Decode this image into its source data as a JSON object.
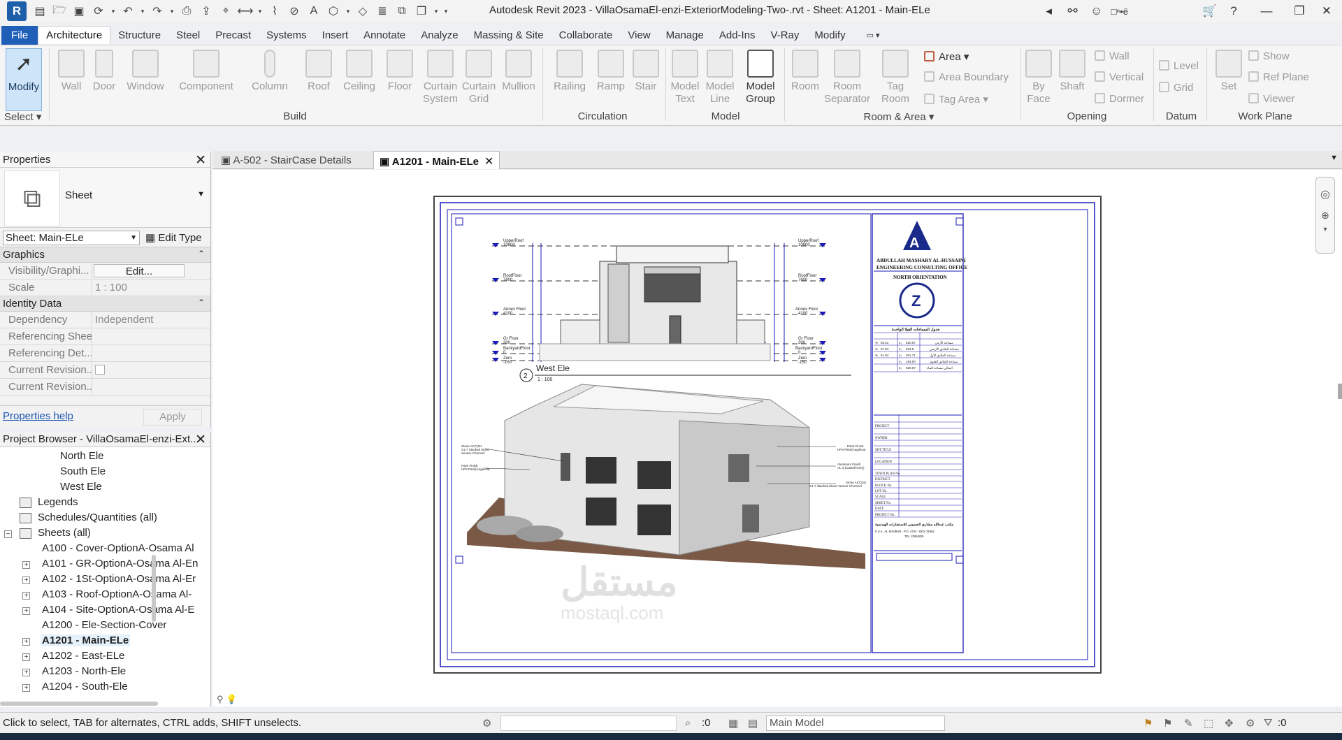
{
  "app": {
    "window_title": "Autodesk Revit 2023 - VillaOsamaEl-enzi-ExteriorModeling-Two-.rvt - Sheet: A1201 - Main-ELe",
    "user": "□ⁿ•ë",
    "logo": "R"
  },
  "ribbon_tabs": [
    "File",
    "Architecture",
    "Structure",
    "Steel",
    "Precast",
    "Systems",
    "Insert",
    "Annotate",
    "Analyze",
    "Massing & Site",
    "Collaborate",
    "View",
    "Manage",
    "Add-Ins",
    "V-Ray",
    "Modify"
  ],
  "ribbon": {
    "modify": "Modify",
    "select_panel": "Select",
    "build": {
      "buttons": [
        "Wall",
        "Door",
        "Window",
        "Component",
        "Column",
        "Roof",
        "Ceiling",
        "Floor",
        "Curtain System",
        "Curtain Grid",
        "Mullion"
      ],
      "label": "Build"
    },
    "circulation": {
      "buttons": [
        "Railing",
        "Ramp",
        "Stair"
      ],
      "label": "Circulation"
    },
    "model": {
      "buttons": [
        "Model Text",
        "Model Line",
        "Model Group"
      ],
      "label": "Model"
    },
    "room_area": {
      "buttons": [
        "Room",
        "Room Separator",
        "Tag Room"
      ],
      "small": [
        "Area",
        "Area  Boundary",
        "Tag  Area"
      ],
      "label": "Room & Area"
    },
    "opening": {
      "buttons": [
        "By Face",
        "Shaft"
      ],
      "small": [
        "Wall",
        "Vertical",
        "Dormer"
      ],
      "label": "Opening"
    },
    "datum": {
      "small": [
        "Level",
        "Grid"
      ],
      "label": "Datum"
    },
    "work_plane": {
      "buttons": [
        "Set"
      ],
      "small": [
        "Show",
        "Ref  Plane",
        "Viewer"
      ],
      "label": "Work Plane"
    }
  },
  "properties": {
    "title": "Properties",
    "type_name": "Sheet",
    "selector": "Sheet: Main-ELe",
    "edit_type": "Edit Type",
    "categories": [
      {
        "name": "Graphics",
        "rows": [
          {
            "name": "Visibility/Graphi...",
            "value": "Edit..."
          },
          {
            "name": "Scale",
            "value": "1 : 100"
          }
        ]
      },
      {
        "name": "Identity Data",
        "rows": [
          {
            "name": "Dependency",
            "value": "Independent"
          },
          {
            "name": "Referencing Sheet",
            "value": ""
          },
          {
            "name": "Referencing Det...",
            "value": ""
          },
          {
            "name": "Current Revision...",
            "value": ""
          },
          {
            "name": "Current Revision...",
            "value": ""
          }
        ]
      }
    ],
    "help": "Properties help",
    "apply": "Apply"
  },
  "browser": {
    "title": "Project Browser - VillaOsamaEl-enzi-Ext...",
    "items": [
      "North Ele",
      "South Ele",
      "West Ele",
      "Legends",
      "Schedules/Quantities (all)",
      "Sheets (all)",
      "A100 - Cover-OptionA-Osama Al",
      "A101 - GR-OptionA-Osama Al-En",
      "A102 - 1St-OptionA-Osama Al-Er",
      "A103 - Roof-OptionA-Osama Al-",
      "A104 - Site-OptionA-Osama Al-E",
      "A1200 - Ele-Section-Cover",
      "A1201 - Main-ELe",
      "A1202 - East-ELe",
      "A1203 - North-Ele",
      "A1204 - South-Ele"
    ]
  },
  "doc_tabs": [
    "A-502 - StairCase Details",
    "A1201 - Main-ELe"
  ],
  "sheet": {
    "elevation_view_number": "2",
    "elevation_title": "West Ele",
    "elevation_scale": "1 : 100",
    "levels_left": [
      {
        "name": "UpperRoof",
        "elev": "10800"
      },
      {
        "name": "RoofFloor",
        "elev": "7600"
      },
      {
        "name": "Annex Floor",
        "elev": "4100"
      },
      {
        "name": "Gr Floor",
        "elev": "300"
      },
      {
        "name": "BackyardFloor",
        "elev": "0"
      },
      {
        "name": "Zero",
        "elev": "-150"
      }
    ],
    "title_block": {
      "company_line1": "ABDULLAH MASHARY AL-HUSSAINI",
      "company_line2": "ENGINEERING CONSULTING OFFICE",
      "north": "NORTH ORIENTATION",
      "area_table_title": "جدول المساحات الفيلا الواحدة",
      "area_rows": [
        [
          "%",
          "56.61",
          "2₁",
          "520.67",
          "مساحة الأرض"
        ],
        [
          "%",
          "57.84",
          "2₁",
          "294.8",
          "مساحة الطابق الأرضي"
        ],
        [
          "%",
          "51.04",
          "2₁",
          "301.71",
          "مساحة الطابق الأول"
        ],
        [
          "",
          "",
          "2₁",
          "154.00",
          "مساحة الطابق العلوي"
        ],
        [
          "",
          "",
          "2₁",
          "520.67",
          "اجمالي مساحة البناء"
        ]
      ],
      "fields": [
        "PROJECT",
        "OWNER",
        "SHT.TITLE",
        "LOCATION",
        "TOWN PLAN No.",
        "DISTRICT",
        "BLOCK No.",
        "LOT No.",
        "SCALE",
        "SHEET No.",
        "DATE",
        "PROJECT No."
      ],
      "arabic_office": "مكتب عبدالله مشاري الحسيني للاستشارات الهندسية",
      "address": "K S A , AL KHOBAR - P.O. 4704 - BOX 31952",
      "tel": "TEL 13804829"
    },
    "annotations_left": [
      "Stone ACC(N1",
      "S1-7 Stacked Stone",
      "Veneer-Chomzol",
      "Paint Finish",
      "HP3 Paint(Angelica)"
    ],
    "annotations_right": [
      "Paint Finish",
      "HP3 Paint(Angelica)",
      "Aluminum Finish",
      "AL-3 (Castell Grey)",
      "Stone ACC(N1",
      "S1-7 Stacked Stone Veneer-Chomzol"
    ],
    "watermark": "مستقل",
    "watermark_sub": "mostaql.com"
  },
  "status": {
    "text": "Click to select, TAB for alternates, CTRL adds, SHIFT unselects.",
    "zero": ":0",
    "model": "Main Model",
    "filter": ":0"
  },
  "colors": {
    "accent": "#1f5fb8",
    "sheet_line": "#1a1ab8"
  }
}
